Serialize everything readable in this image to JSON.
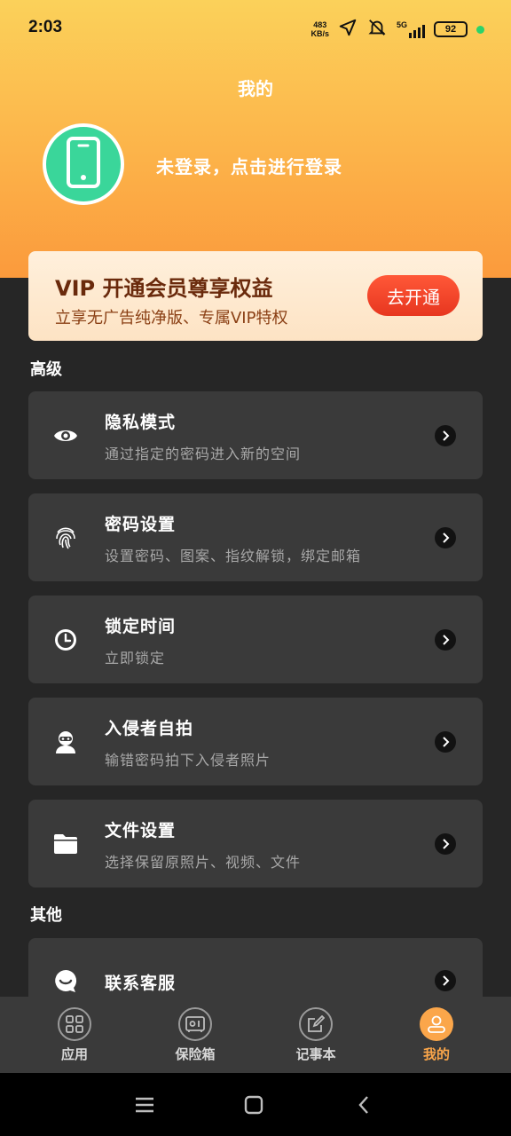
{
  "status_bar": {
    "time": "2:03",
    "net_speed_value": "483",
    "net_speed_unit": "KB/s",
    "signal": "5G",
    "battery": "92"
  },
  "header": {
    "title": "我的",
    "login_prompt": "未登录，点击进行登录"
  },
  "vip": {
    "title": "VIP 开通会员尊享权益",
    "subtitle": "立享无广告纯净版、专属VIP特权",
    "button": "去开通"
  },
  "sections": {
    "advanced": "高级",
    "other": "其他"
  },
  "items": [
    {
      "title": "隐私模式",
      "subtitle": "通过指定的密码进入新的空间",
      "icon": "eye-icon"
    },
    {
      "title": "密码设置",
      "subtitle": "设置密码、图案、指纹解锁，绑定邮箱",
      "icon": "fingerprint-icon"
    },
    {
      "title": "锁定时间",
      "subtitle": "立即锁定",
      "icon": "clock-icon"
    },
    {
      "title": "入侵者自拍",
      "subtitle": "输错密码拍下入侵者照片",
      "icon": "intruder-icon"
    },
    {
      "title": "文件设置",
      "subtitle": "选择保留原照片、视频、文件",
      "icon": "folder-icon"
    },
    {
      "title": "联系客服",
      "subtitle": "",
      "icon": "chat-icon"
    }
  ],
  "tabs": [
    {
      "label": "应用",
      "icon": "apps-grid-icon"
    },
    {
      "label": "保险箱",
      "icon": "safe-icon"
    },
    {
      "label": "记事本",
      "icon": "notepad-icon"
    },
    {
      "label": "我的",
      "icon": "user-icon",
      "active": true
    }
  ],
  "colors": {
    "accent": "#fba64a",
    "vip_button": "#e7361f",
    "avatar": "#3ad69a"
  }
}
